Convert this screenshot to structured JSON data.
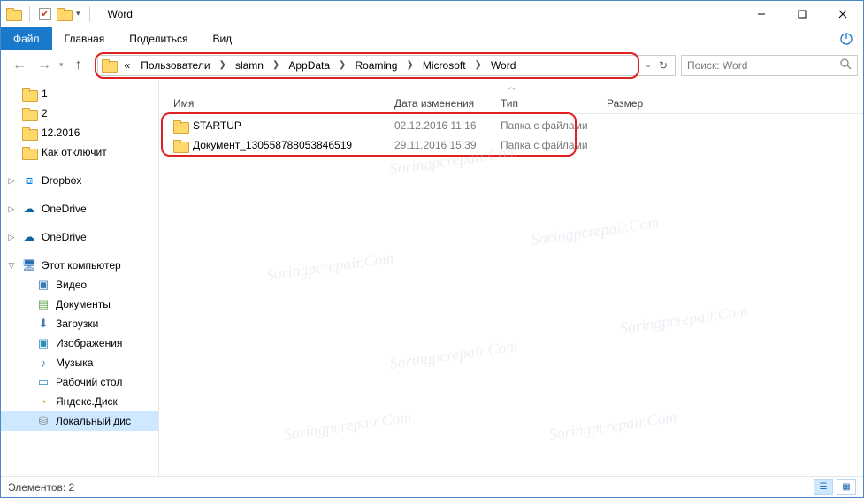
{
  "window": {
    "title": "Word"
  },
  "ribbon": {
    "file": "Файл",
    "home": "Главная",
    "share": "Поделиться",
    "view": "Вид"
  },
  "breadcrumb": {
    "overflow": "«",
    "segs": [
      "Пользователи",
      "slamn",
      "AppData",
      "Roaming",
      "Microsoft",
      "Word"
    ]
  },
  "search": {
    "placeholder": "Поиск: Word"
  },
  "nav": {
    "quick": [
      {
        "label": "1"
      },
      {
        "label": "2"
      },
      {
        "label": "12.2016"
      },
      {
        "label": "Как отключит"
      }
    ],
    "dropbox": "Dropbox",
    "onedrive1": "OneDrive",
    "onedrive2": "OneDrive",
    "thispc": "Этот компьютер",
    "pc_children": [
      {
        "label": "Видео"
      },
      {
        "label": "Документы"
      },
      {
        "label": "Загрузки"
      },
      {
        "label": "Изображения"
      },
      {
        "label": "Музыка"
      },
      {
        "label": "Рабочий стол"
      },
      {
        "label": "Яндекс.Диск"
      },
      {
        "label": "Локальный дис"
      }
    ]
  },
  "columns": {
    "name": "Имя",
    "date": "Дата изменения",
    "type": "Тип",
    "size": "Размер"
  },
  "rows": [
    {
      "name": "STARTUP",
      "date": "02.12.2016 11:16",
      "type": "Папка с файлами"
    },
    {
      "name": "Документ_130558788053846519",
      "date": "29.11.2016 15:39",
      "type": "Папка с файлами"
    }
  ],
  "status": {
    "count_label": "Элементов: 2"
  },
  "watermark": "Soringpcrepair.Com"
}
